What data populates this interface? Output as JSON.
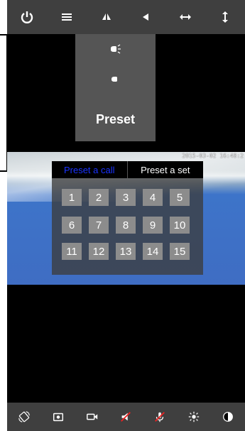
{
  "top_toolbar": {
    "icons": [
      "power-icon",
      "menu-icon",
      "flip-icon",
      "mirror-icon",
      "horizontal-scan-icon",
      "vertical-scan-icon"
    ]
  },
  "dropdown": {
    "items": [
      "ir-light-on-icon",
      "ir-light-off-icon"
    ],
    "preset_label": "Preset"
  },
  "video": {
    "timestamp": "2015-03-02 16:48:2"
  },
  "preset_panel": {
    "tabs": [
      {
        "label": "Preset a call",
        "active": true
      },
      {
        "label": "Preset a set",
        "active": false
      }
    ],
    "numbers": [
      "1",
      "2",
      "3",
      "4",
      "5",
      "6",
      "7",
      "8",
      "9",
      "10",
      "11",
      "12",
      "13",
      "14",
      "15"
    ]
  },
  "bottom_toolbar": {
    "icons": [
      "rotate-icon",
      "snapshot-icon",
      "record-icon",
      "speaker-muted-icon",
      "mic-muted-icon",
      "brightness-icon",
      "contrast-icon"
    ]
  },
  "colors": {
    "toolbar": "#3f3f3f",
    "dropdown": "#555555",
    "tab_active": "#1a33ff",
    "number_button": "#8c8c8c"
  }
}
